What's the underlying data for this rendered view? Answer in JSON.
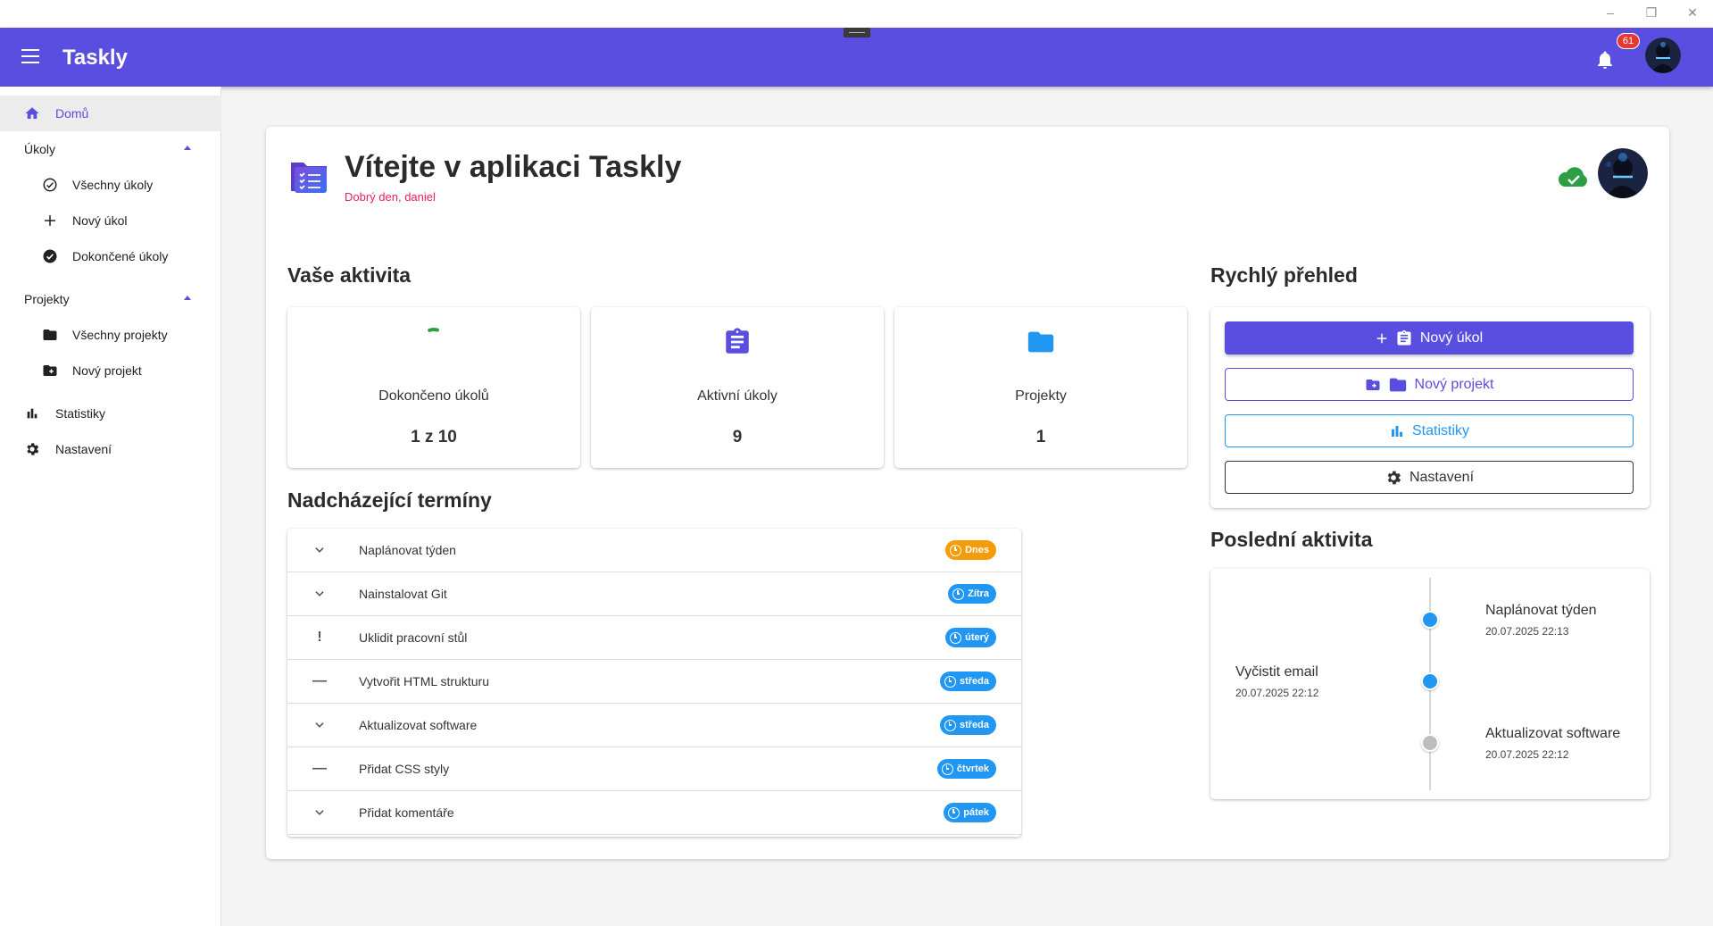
{
  "app": {
    "title": "Taskly",
    "notifications_count": "61"
  },
  "sidebar": {
    "home": "Domů",
    "tasks_section": "Úkoly",
    "tasks_items": [
      "Všechny úkoly",
      "Nový úkol",
      "Dokončené úkoly"
    ],
    "projects_section": "Projekty",
    "projects_items": [
      "Všechny projekty",
      "Nový projekt"
    ],
    "statistics": "Statistiky",
    "settings": "Nastavení"
  },
  "welcome": {
    "title": "Vítejte v aplikaci Taskly",
    "subtitle": "Dobrý den, daniel"
  },
  "activity": {
    "heading": "Vaše aktivita",
    "cards": [
      {
        "label": "Dokončeno úkolů",
        "value": "1 z 10",
        "progress_fraction": 0.1
      },
      {
        "label": "Aktivní úkoly",
        "value": "9"
      },
      {
        "label": "Projekty",
        "value": "1"
      }
    ]
  },
  "deadlines": {
    "heading": "Nadcházející termíny",
    "rows": [
      {
        "priority": "low",
        "text": "Naplánovat týden",
        "due": "Dnes",
        "color": "#f59c0b"
      },
      {
        "priority": "low",
        "text": "Nainstalovat Git",
        "due": "Zítra",
        "color": "#2196f3"
      },
      {
        "priority": "high",
        "text": "Uklidit pracovní stůl",
        "due": "úterý",
        "color": "#2196f3"
      },
      {
        "priority": "medium",
        "text": "Vytvořit HTML strukturu",
        "due": "středa",
        "color": "#2196f3"
      },
      {
        "priority": "low",
        "text": "Aktualizovat software",
        "due": "středa",
        "color": "#2196f3"
      },
      {
        "priority": "medium",
        "text": "Přidat CSS styly",
        "due": "čtvrtek",
        "color": "#2196f3"
      },
      {
        "priority": "low",
        "text": "Přidat komentáře",
        "due": "pátek",
        "color": "#2196f3"
      }
    ]
  },
  "quick_overview": {
    "heading": "Rychlý přehled",
    "new_task": "Nový úkol",
    "new_project": "Nový projekt",
    "statistics": "Statistiky",
    "settings": "Nastavení"
  },
  "recent_activity": {
    "heading": "Poslední aktivita",
    "items": [
      {
        "title": "Naplánovat týden",
        "time": "20.07.2025 22:13",
        "side": "right",
        "color": "#2196f3"
      },
      {
        "title": "Vyčistit email",
        "time": "20.07.2025 22:12",
        "side": "left",
        "color": "#2196f3"
      },
      {
        "title": "Aktualizovat software",
        "time": "20.07.2025 22:12",
        "side": "right",
        "color": "#bdbdbd"
      }
    ]
  },
  "colors": {
    "primary": "#5a4ee0",
    "accent": "#e91e63",
    "info": "#2196f3",
    "warning": "#f59c0b",
    "success": "#2e9e44"
  }
}
